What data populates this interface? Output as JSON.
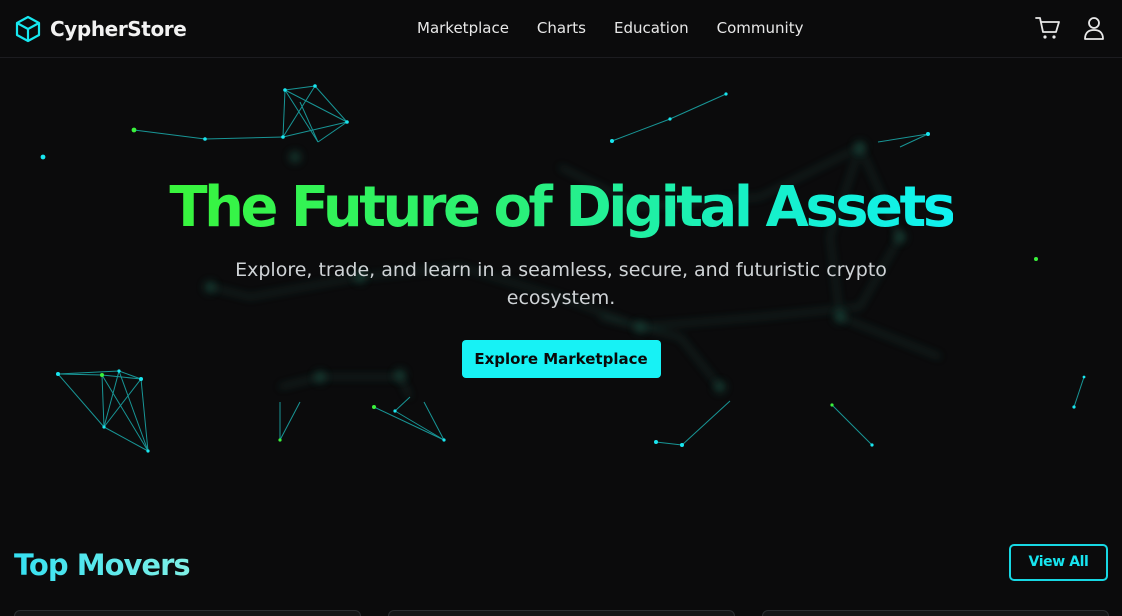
{
  "brand": {
    "name": "CypherStore",
    "accent_color": "#17f2f5",
    "logo_icon": "cube-icon"
  },
  "nav": {
    "items": [
      "Marketplace",
      "Charts",
      "Education",
      "Community"
    ]
  },
  "header_icons": {
    "cart": "cart-icon",
    "account": "user-icon"
  },
  "hero": {
    "title": "The Future of Digital Assets",
    "subtitle": "Explore, trade, and learn in a seamless, secure, and futuristic crypto ecosystem.",
    "cta_label": "Explore Marketplace",
    "gradient_colors": [
      "#39f53c",
      "#2af07a",
      "#16f0c8",
      "#10f2f2"
    ]
  },
  "top_movers": {
    "title": "Top Movers",
    "view_all_label": "View All"
  }
}
